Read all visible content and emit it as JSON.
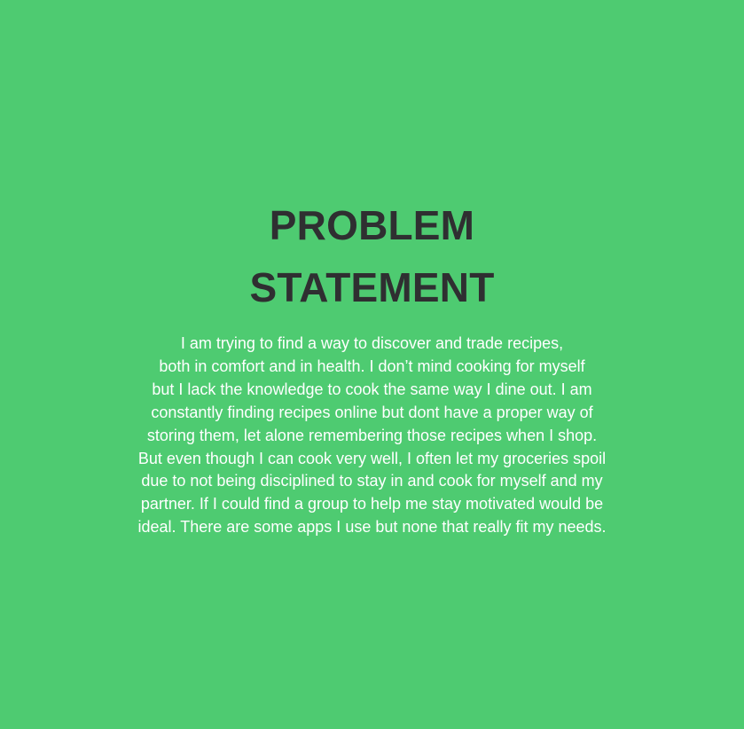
{
  "background_color": "#4ecb71",
  "title_color": "#2f2f31",
  "text_color": "#ffffff",
  "title": {
    "line1": "PROBLEM",
    "line2": "STATEMENT"
  },
  "statement_lines": [
    "I am trying to find a way to discover and trade recipes,",
    "both in comfort and in health. I don’t mind cooking for myself",
    "but I lack the knowledge to cook the same way I dine out. I am",
    "constantly finding recipes online but dont have a proper way of",
    "storing them, let alone remembering those recipes when I shop.",
    "But even though I can cook very well, I often let my groceries spoil",
    "due to not being disciplined to stay in and cook for myself and my",
    "partner. If I could find a group to help me stay motivated would be",
    "ideal. There are some apps I use but none that really fit my needs."
  ]
}
